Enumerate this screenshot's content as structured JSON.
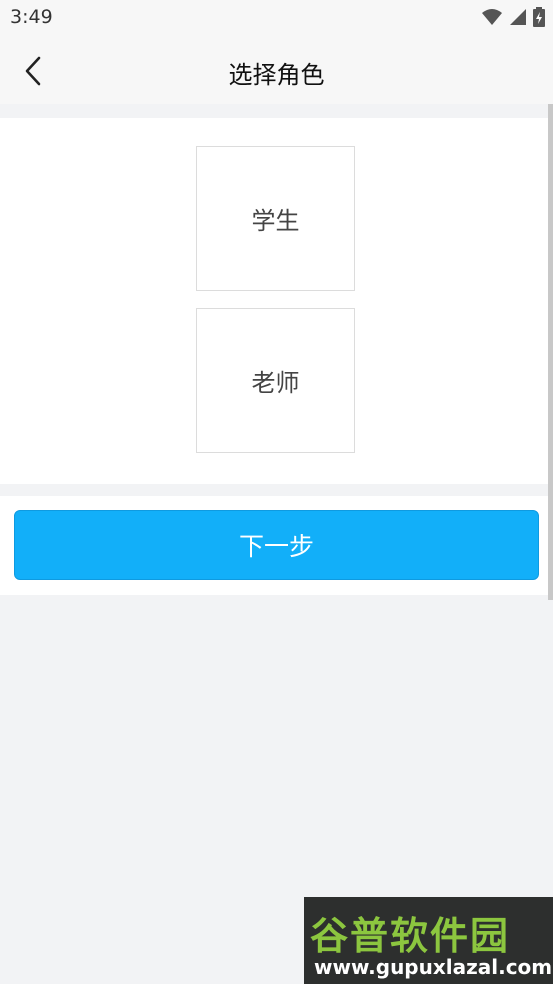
{
  "status_bar": {
    "time": "3:49",
    "icons": [
      "wifi-icon",
      "signal-icon",
      "battery-charging-icon"
    ]
  },
  "header": {
    "title": "选择角色",
    "back_icon": "chevron-left-icon"
  },
  "roles": [
    {
      "label": "学生"
    },
    {
      "label": "老师"
    }
  ],
  "actions": {
    "next_label": "下一步"
  },
  "watermark": {
    "brand": "谷普软件园",
    "url": "www.gupuxlazal.com"
  },
  "colors": {
    "primary": "#12aff9",
    "background": "#f2f3f5",
    "panel": "#ffffff"
  }
}
